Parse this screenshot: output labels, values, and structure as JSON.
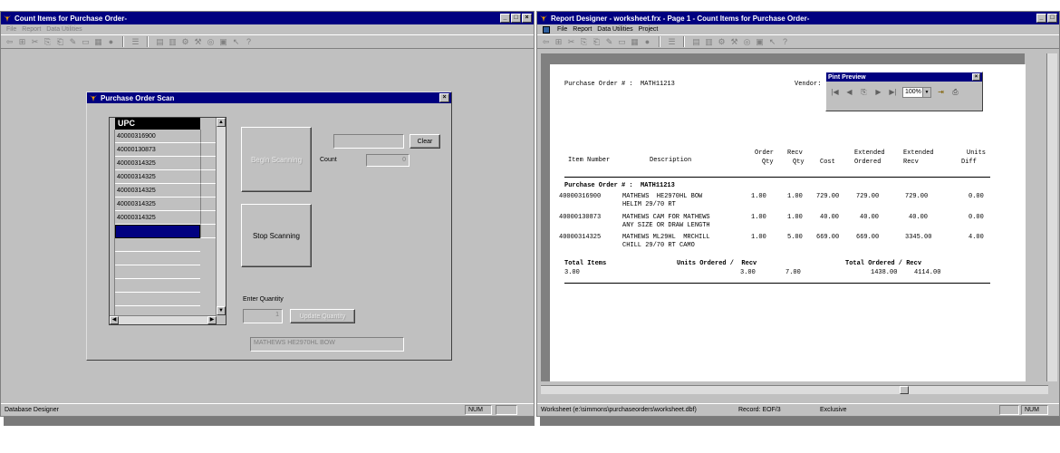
{
  "left_window": {
    "title": "Count Items for Purchase Order-",
    "menu": [
      "File",
      "Report",
      "Data Utilities"
    ],
    "status": "Database Designer",
    "num": "NUM"
  },
  "dialog": {
    "title": "Purchase Order Scan",
    "grid_header": "UPC",
    "grid_rows": [
      "40000316900",
      "40000130873",
      "40000314325",
      "40000314325",
      "40000314325",
      "40000314325",
      "40000314325",
      ""
    ],
    "begin_label": "Begin Scanning",
    "stop_label": "Stop Scanning",
    "clear_label": "Clear",
    "count_label": "Count",
    "count_value": "0",
    "scan_input": "",
    "enter_qty_label": "Enter Quantity",
    "qty_value": "1",
    "update_label": "Update Quantity",
    "description": "MATHEWS  HE2970HL BOW"
  },
  "right_window": {
    "title": "Report Designer - worksheet.frx - Page 1 - Count Items for Purchase Order-",
    "menu": [
      "File",
      "Report",
      "Data Utilities",
      "Project"
    ],
    "status_path": "Worksheet (e:\\simmons\\purchaseorders\\worksheet.dbf)",
    "status_record": "Record: EOF/3",
    "status_mode": "Exclusive",
    "num": "NUM"
  },
  "print_preview": {
    "title": "Pint Preview",
    "zoom": "100%"
  },
  "report": {
    "po_label": "Purchase Order # :  MATH11213",
    "vendor_label": "Vendor:",
    "headers": {
      "item": "Item Number",
      "desc": "Description",
      "order1": "Order",
      "order2": "Qty",
      "recv1": "Recv",
      "recv2": "Qty",
      "cost": "Cost",
      "ext_ord1": "Extended",
      "ext_ord2": "Ordered",
      "ext_recv1": "Extended",
      "ext_recv2": "Recv",
      "units1": "Units",
      "units2": "Diff"
    },
    "group_label": "Purchase Order # :  MATH11213",
    "rows": [
      {
        "item": "40000316900",
        "desc1": "MATHEWS  HE2970HL BOW",
        "desc2": "HELIM 29/70 RT",
        "order": "1.00",
        "recv": "1.00",
        "cost": "729.00",
        "ext_ord": "729.00",
        "ext_recv": "729.00",
        "diff": "0.00"
      },
      {
        "item": "40000130873",
        "desc1": "MATHEWS CAM FOR MATHEWS",
        "desc2": "ANY SIZE OR DRAW LENGTH",
        "order": "1.00",
        "recv": "1.00",
        "cost": "40.00",
        "ext_ord": "40.00",
        "ext_recv": "40.00",
        "diff": "0.00"
      },
      {
        "item": "40000314325",
        "desc1": "MATHEWS ML29HL  MRCHILL",
        "desc2": "CHILL 29/70 RT CAMO",
        "order": "1.00",
        "recv": "5.00",
        "cost": "669.00",
        "ext_ord": "669.00",
        "ext_recv": "3345.00",
        "diff": "4.00"
      }
    ],
    "totals": {
      "items_label": "Total Items",
      "items_value": "3.00",
      "units_label": "Units Ordered /  Recv",
      "units_ordered": "3.00",
      "units_recv": "7.00",
      "total_label": "Total Ordered / Recv",
      "total_ordered": "1438.00",
      "total_recv": "4114.00"
    }
  }
}
